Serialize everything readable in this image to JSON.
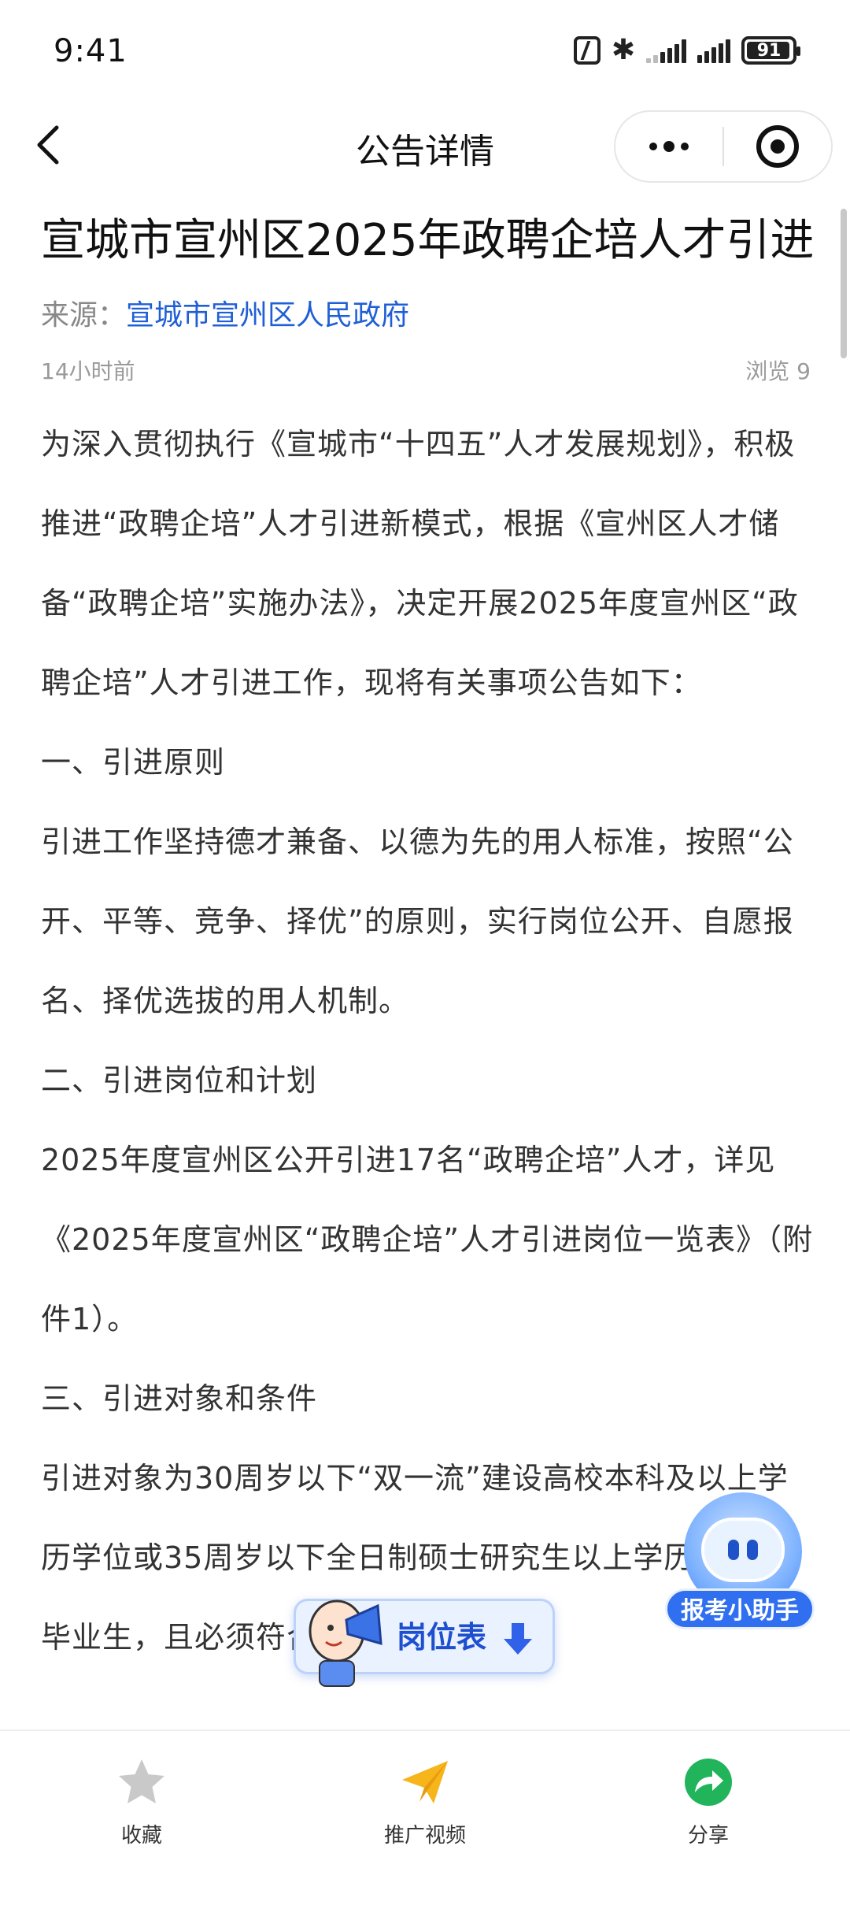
{
  "status_bar": {
    "time": "9:41",
    "battery": "91"
  },
  "nav": {
    "title": "公告详情"
  },
  "article": {
    "title": "宣城市宣州区2025年政聘企培人才引进",
    "source_label": "来源：",
    "source_name": "宣城市宣州区人民政府",
    "time_ago": "14小时前",
    "views": "浏览 9",
    "paragraphs": [
      "为深入贯彻执行《宣城市“十四五”人才发展规划》，积极推进“政聘企培”人才引进新模式，根据《宣州区人才储备“政聘企培”实施办法》，决定开展2025年度宣州区“政聘企培”人才引进工作，现将有关事项公告如下：",
      "一、引进原则",
      "引进工作坚持德才兼备、以德为先的用人标准，按照“公开、平等、竞争、择优”的原则，实行岗位公开、自愿报名、择优选拔的用人机制。",
      "二、引进岗位和计划",
      "2025年度宣州区公开引进17名“政聘企培”人才，详见《2025年度宣州区“政聘企培”人才引进岗位一览表》（附件1）。",
      "三、引进对象和条件",
      "引进对象为30周岁以下“双一流”建设高校本科及以上学历学位或35周岁以下全日制硕士研究生以上学历学位的毕业生，且必须符合下列条件："
    ]
  },
  "floating": {
    "assistant_label": "报考小助手",
    "post_table_label": "岗位表"
  },
  "bottom_tabs": {
    "favorite": "收藏",
    "promo_video": "推广视频",
    "share": "分享"
  }
}
